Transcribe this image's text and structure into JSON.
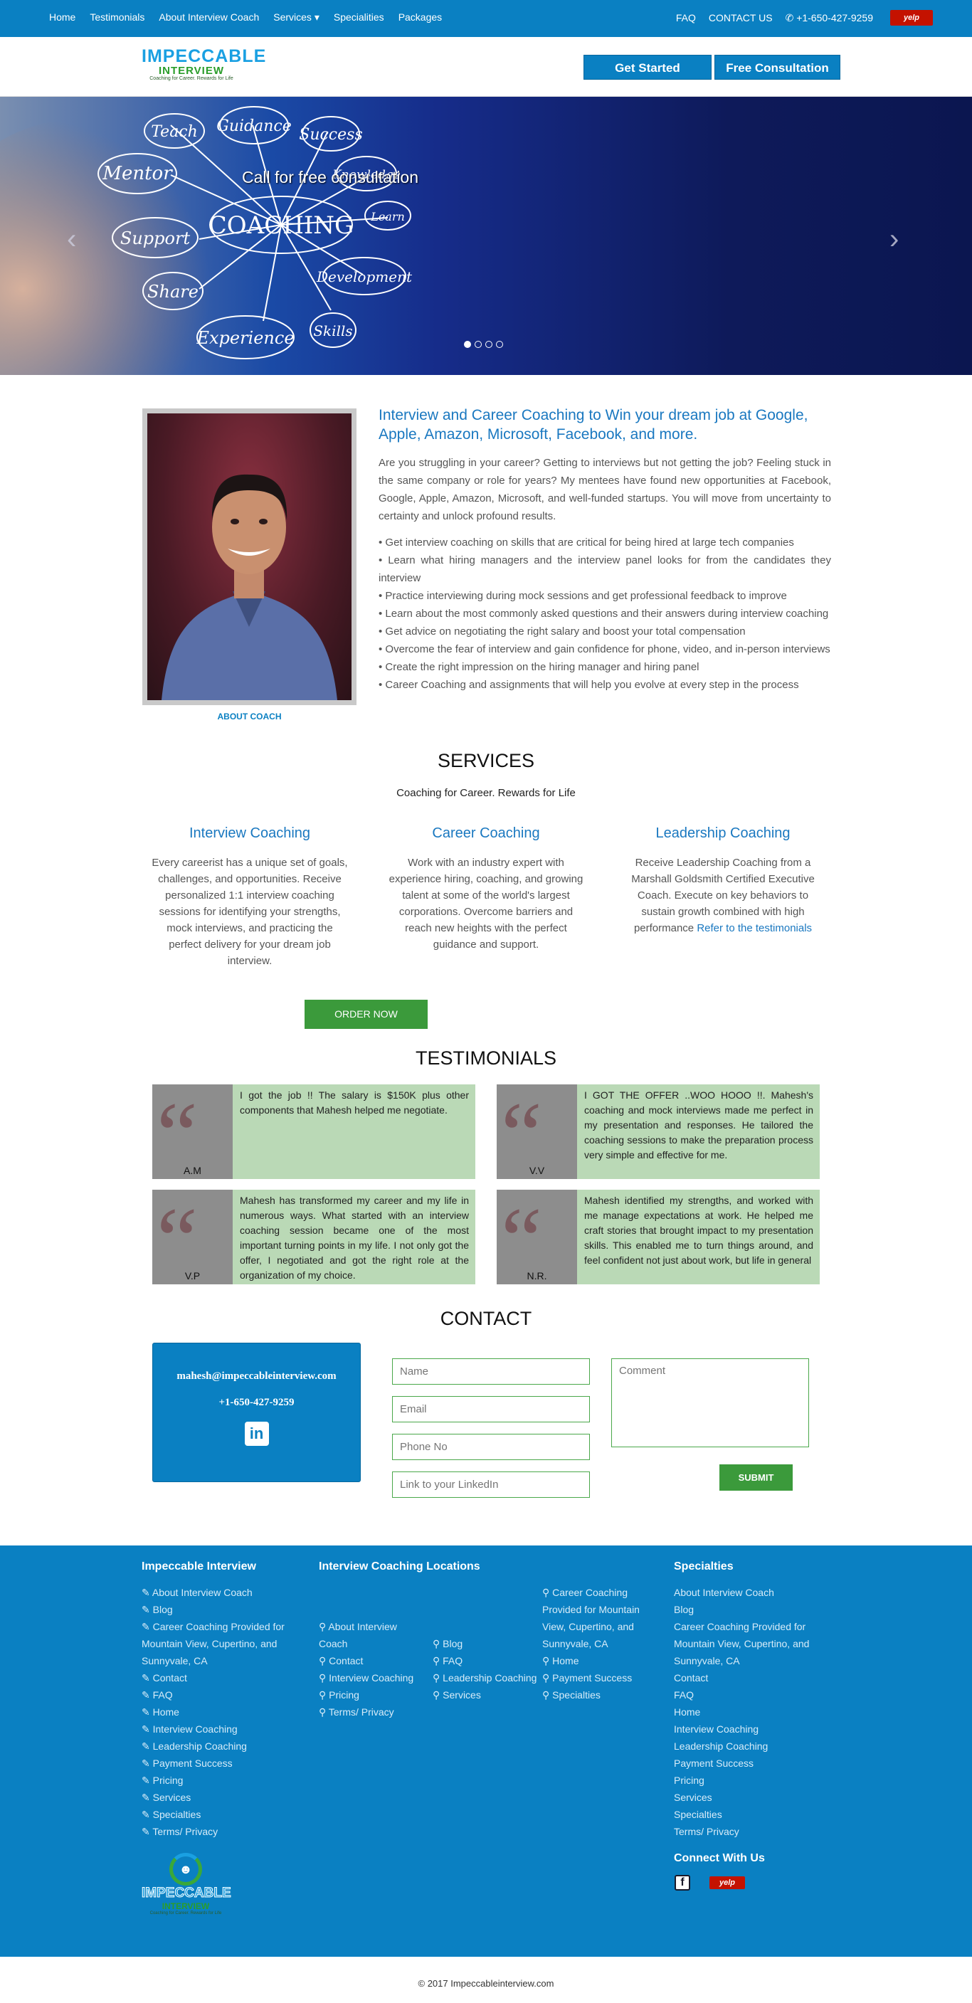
{
  "topnav": {
    "left": [
      "Home",
      "Testimonials",
      "About Interview Coach",
      "Services ▾",
      "Specialities",
      "Packages"
    ],
    "faq": "FAQ",
    "contact": "CONTACT US",
    "phone": "+1-650-427-9259",
    "yelp": "yelp"
  },
  "logo": {
    "line1": "IMPECCABLE",
    "line2": "INTERVIEW",
    "tagline": "Coaching for Career. Rewards for Life"
  },
  "header": {
    "get_started": "Get Started",
    "free_consult": "Free Consultation"
  },
  "hero": {
    "caption": "Call for free consultation",
    "words": [
      "Teach",
      "Guidance",
      "Success",
      "Mentor",
      "Knowledge",
      "Learn",
      "Support",
      "COACHING",
      "Share",
      "Development",
      "Experience",
      "Skills"
    ],
    "prev": "‹",
    "next": "›"
  },
  "about_link": "ABOUT COACH",
  "intro": {
    "title": "Interview and Career Coaching to Win your dream job at Google, Apple, Amazon, Microsoft, Facebook, and more.",
    "paragraph": "Are you struggling in your career? Getting to interviews but not getting the job? Feeling stuck in the same company or role for years? My mentees have found new opportunities at Facebook, Google, Apple, Amazon, Microsoft, and well-funded startups. You will move from uncertainty to certainty and unlock profound results.",
    "bullets": [
      "• Get interview coaching on skills that are critical for being hired at large tech companies",
      "• Learn what hiring managers and the interview panel looks for from the candidates they interview",
      "• Practice interviewing during mock sessions and get professional feedback to improve",
      "• Learn about the most commonly asked questions and their answers during interview coaching",
      "• Get advice on negotiating the right salary and boost your total compensation",
      "• Overcome the fear of interview and gain confidence for phone, video, and in-person interviews",
      "• Create the right impression on the hiring manager and hiring panel",
      "• Career Coaching and assignments that will help you evolve at every step in the process"
    ]
  },
  "services": {
    "heading": "SERVICES",
    "subtitle": "Coaching for Career. Rewards for Life",
    "items": [
      {
        "title": "Interview Coaching",
        "text": "Every careerist has a unique set of goals, challenges, and opportunities. Receive personalized 1:1 interview coaching sessions for identifying your strengths, mock interviews, and practicing the perfect delivery for your dream job interview."
      },
      {
        "title": "Career Coaching",
        "text": "Work with an industry expert with experience hiring, coaching, and growing talent at some of the world's largest corporations. Overcome barriers and reach new heights with the perfect guidance and support."
      },
      {
        "title": "Leadership Coaching",
        "text": "Receive Leadership Coaching from a Marshall Goldsmith Certified Executive Coach. Execute on key behaviors to sustain growth combined with high performance ",
        "link": "Refer to the testimonials"
      }
    ],
    "order": "ORDER NOW"
  },
  "testimonials": {
    "heading": "TESTIMONIALS",
    "items": [
      {
        "name": "A.M",
        "text": "I got the job !! The salary is $150K plus other components that Mahesh helped me negotiate."
      },
      {
        "name": "V.V",
        "text": "I GOT THE OFFER ..WOO HOOO !!. Mahesh's coaching and mock interviews made me perfect in my presentation and responses. He tailored the coaching sessions to make the preparation process very simple and effective for me."
      },
      {
        "name": "V.P",
        "text": "Mahesh has transformed my career and my life in numerous ways. What started with an interview coaching session became one of the most important turning points in my life. I not only got the offer, I negotiated and got the right role at the organization of my choice."
      },
      {
        "name": "N.R.",
        "text": "Mahesh identified my strengths, and worked with me manage expectations at work. He helped me craft stories that brought impact to my presentation skills. This enabled me to turn things around, and feel confident not just about work, but life in general"
      }
    ]
  },
  "contact": {
    "heading": "CONTACT",
    "email": "mahesh@impeccableinterview.com",
    "phone": "+1-650-427-9259",
    "linkedin": "in",
    "name_ph": "Name",
    "email_ph": "Email",
    "phone_ph": "Phone No",
    "linkedin_ph": "Link to your LinkedIn",
    "comment_ph": "Comment",
    "submit": "SUBMIT"
  },
  "footer": {
    "col1_title": "Impeccable Interview",
    "col1": [
      "About Interview Coach",
      "Blog",
      "Career Coaching Provided for Mountain View, Cupertino, and Sunnyvale, CA",
      "Contact",
      "FAQ",
      "Home",
      "Interview Coaching",
      "Leadership Coaching",
      "Payment Success",
      "Pricing",
      "Services",
      "Specialties",
      "Terms/ Privacy"
    ],
    "col2_title": "Interview Coaching Locations",
    "col2a": [
      "About Interview Coach",
      "Contact",
      "Interview Coaching",
      "Pricing",
      "Terms/ Privacy"
    ],
    "col2b": [
      "Blog",
      "FAQ",
      "Leadership Coaching",
      "Services"
    ],
    "col2c": [
      "Career Coaching Provided for Mountain View, Cupertino, and Sunnyvale, CA",
      "Home",
      "Payment Success",
      "Specialties"
    ],
    "col3_title": "Specialties",
    "col3": [
      "About Interview Coach",
      "Blog",
      "Career Coaching Provided for Mountain View, Cupertino, and Sunnyvale, CA",
      "Contact",
      "FAQ",
      "Home",
      "Interview Coaching",
      "Leadership Coaching",
      "Payment Success",
      "Pricing",
      "Services",
      "Specialties",
      "Terms/ Privacy"
    ],
    "connect": "Connect With Us",
    "fb": "f",
    "yelp": "yelp"
  },
  "copyright": "© 2017 Impeccableinterview.com"
}
